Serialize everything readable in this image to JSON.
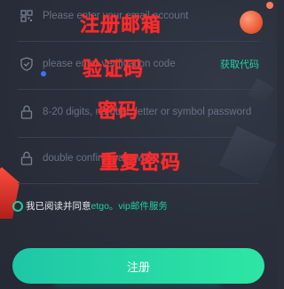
{
  "form": {
    "email_placeholder": "Please enter your email account",
    "code_placeholder": "please enter verification code",
    "get_code_label": "获取代码",
    "password_placeholder": "8-20 digits, number, letter or symbol password",
    "confirm_placeholder": "double confirm password"
  },
  "annotations": {
    "email": "注册邮箱",
    "code": "验证码",
    "password": "密码",
    "confirm": "重复密码"
  },
  "agreement": {
    "prefix": "我已阅读并同意",
    "link": "etgo。vip邮件服务"
  },
  "register_button_label": "注册",
  "colors": {
    "accent": "#1fd0a0",
    "annotation": "#ff2b2b",
    "background": "#2a2f3b"
  },
  "icons": {
    "email": "qr-grid-icon",
    "code": "shield-check-icon",
    "password": "lock-icon",
    "confirm": "lock-icon"
  }
}
